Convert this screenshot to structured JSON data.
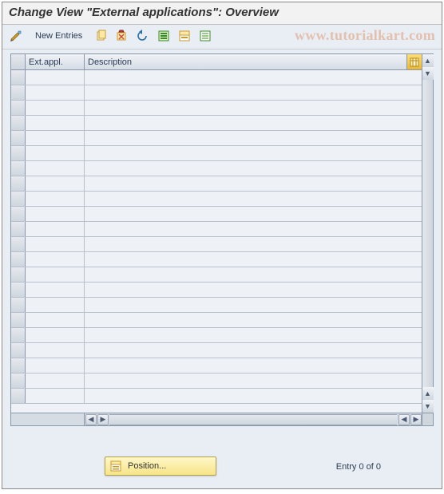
{
  "header": {
    "title": "Change View \"External applications\": Overview"
  },
  "toolbar": {
    "new_entries_label": "New Entries"
  },
  "watermark": "www.tutorialkart.com",
  "table": {
    "columns": {
      "ext": "Ext.appl.",
      "desc": "Description"
    },
    "row_count": 22
  },
  "footer": {
    "position_label": "Position...",
    "entry_text": "Entry 0 of 0"
  }
}
